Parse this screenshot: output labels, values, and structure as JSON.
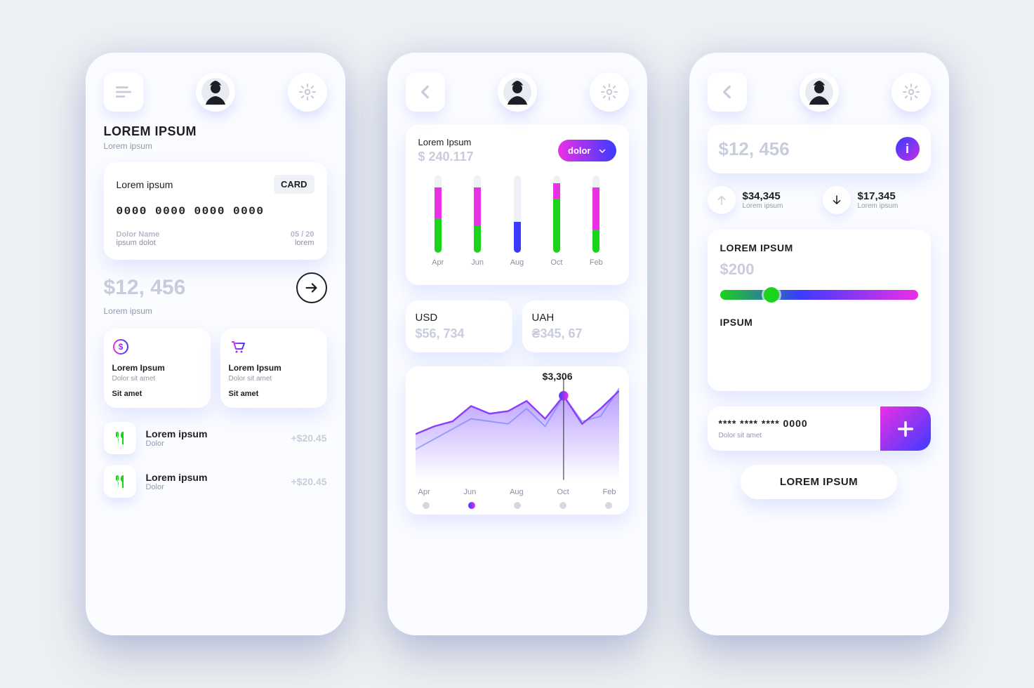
{
  "colors": {
    "green": "#19d419",
    "magenta": "#eb2fe5",
    "blue": "#3b3bff",
    "bluepurple": "#6a3bff"
  },
  "screen1": {
    "title": "LOREM IPSUM",
    "subtitle": "Lorem ipsum",
    "card": {
      "label": "Lorem ipsum",
      "badge": "CARD",
      "number": "0000 0000 0000 0000",
      "holder_label": "Dolor Name",
      "holder_value": "ipsum dolot",
      "exp_label": "05 / 20",
      "exp_value": "lorem"
    },
    "balance": {
      "amount": "$12, 456",
      "sub": "Lorem ipsum"
    },
    "mini": [
      {
        "icon": "dollar-icon",
        "title": "Lorem Ipsum",
        "sub": "Dolor sit amet",
        "btn": "Sit amet"
      },
      {
        "icon": "cart-icon",
        "title": "Lorem Ipsum",
        "sub": "Dolor sit amet",
        "btn": "Sit amet"
      }
    ],
    "tx": [
      {
        "title": "Lorem ipsum",
        "sub": "Dolor",
        "amount": "+$20.45"
      },
      {
        "title": "Lorem ipsum",
        "sub": "Dolor",
        "amount": "+$20.45"
      }
    ]
  },
  "screen2": {
    "header": {
      "label": "Lorem Ipsum",
      "value": "$ 240.117",
      "dropdown_label": "dolor"
    },
    "currencies": [
      {
        "code": "USD",
        "value": "$56, 734"
      },
      {
        "code": "UAH",
        "value": "₴345, 67"
      }
    ],
    "line_chart_peak": "$3,306"
  },
  "screen3": {
    "balance": "$12, 456",
    "io": [
      {
        "dir": "up",
        "amount": "$34,345",
        "sub": "Lorem ipsum"
      },
      {
        "dir": "down",
        "amount": "$17,345",
        "sub": "Lorem ipsum"
      }
    ],
    "slider": {
      "title": "LOREM IPSUM",
      "amount": "$200",
      "footer": "IPSUM"
    },
    "add_card": {
      "number": "**** **** **** 0000",
      "sub": "Dolor sit amet"
    },
    "cta": "LOREM IPSUM"
  },
  "chart_data": [
    {
      "type": "bar",
      "title": "Lorem Ipsum",
      "categories": [
        "Apr",
        "Jun",
        "Aug",
        "Oct",
        "Feb"
      ],
      "series": [
        {
          "name": "green",
          "values": [
            45,
            35,
            0,
            70,
            30
          ]
        },
        {
          "name": "magenta",
          "values": [
            40,
            50,
            0,
            20,
            55
          ]
        },
        {
          "name": "blue",
          "values": [
            0,
            0,
            40,
            0,
            0
          ]
        }
      ],
      "ylim": [
        0,
        100
      ],
      "stacked": true
    },
    {
      "type": "line",
      "title": "",
      "categories": [
        "Apr",
        "Jun",
        "Aug",
        "Oct",
        "Feb"
      ],
      "series": [
        {
          "name": "secondary",
          "values": [
            1200,
            1600,
            2000,
            2400,
            2300,
            2200,
            2800,
            2100,
            3300,
            2300,
            2500,
            3600
          ]
        },
        {
          "name": "primary",
          "values": [
            1800,
            2100,
            2300,
            2900,
            2600,
            2700,
            3100,
            2400,
            3306,
            2200,
            2800,
            3500
          ]
        }
      ],
      "ylim": [
        0,
        4000
      ],
      "highlight": {
        "index": 8,
        "value": 3306
      }
    }
  ]
}
